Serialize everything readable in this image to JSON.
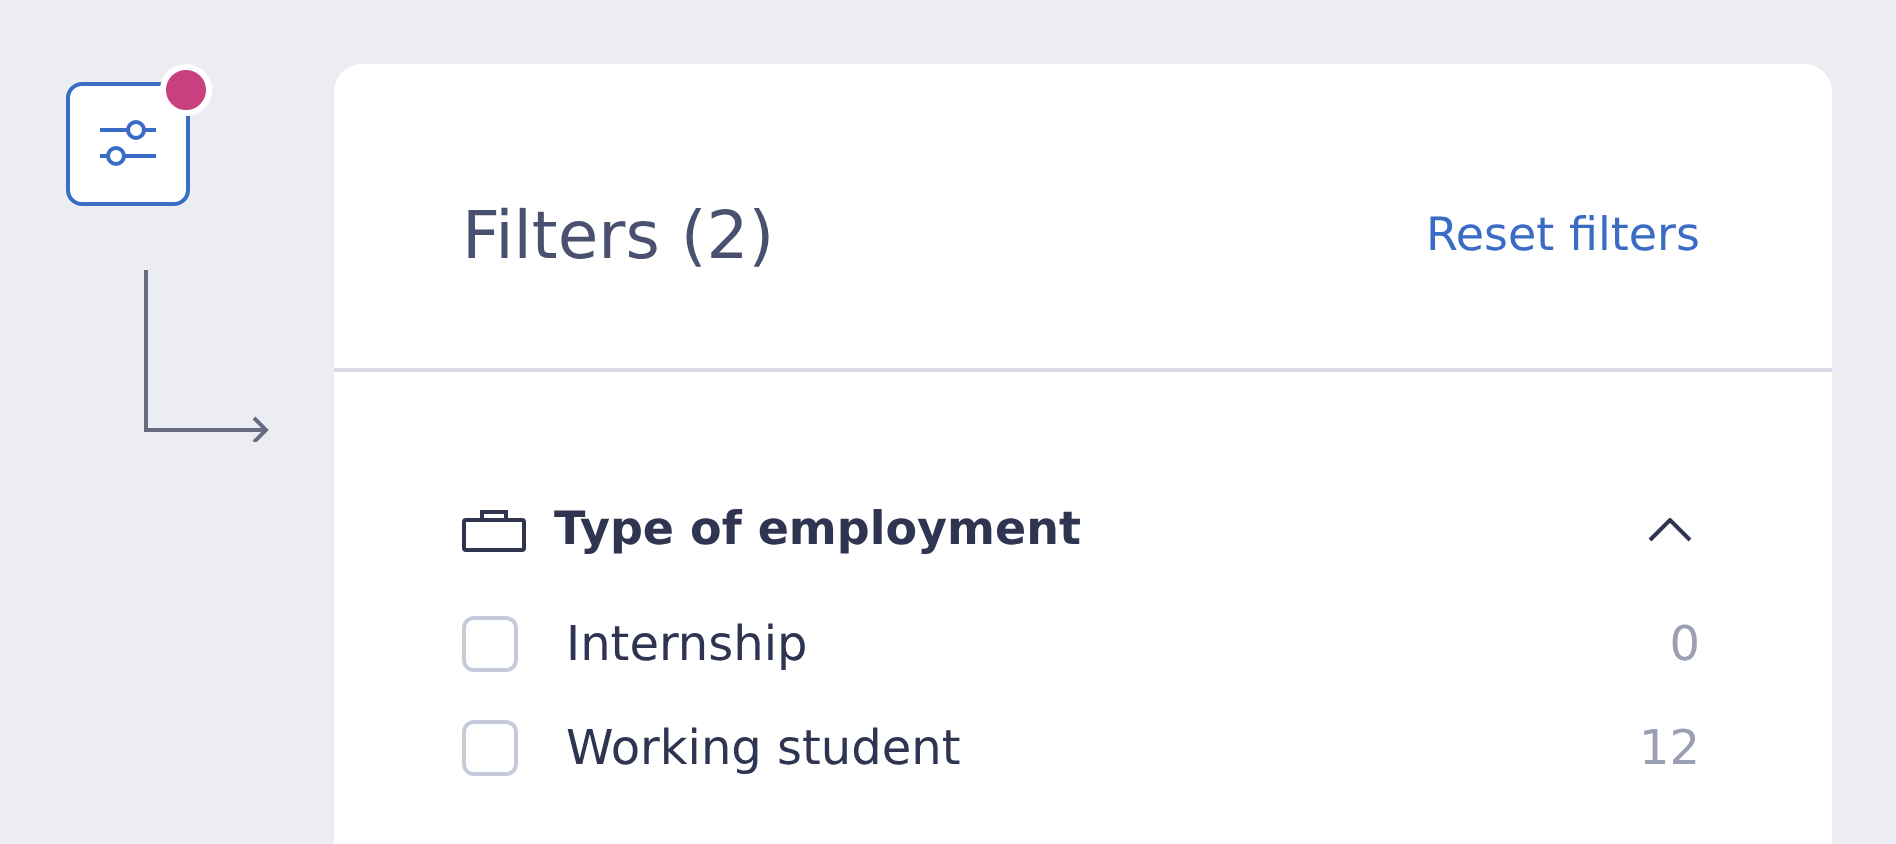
{
  "filter_button": {
    "has_active_filters": true
  },
  "panel": {
    "title": "Filters (2)",
    "reset_link": "Reset filters",
    "sections": [
      {
        "title": "Type of employment",
        "expanded": true,
        "options": [
          {
            "label": "Internship",
            "count": "0",
            "checked": false
          },
          {
            "label": "Working student",
            "count": "12",
            "checked": false
          }
        ]
      }
    ]
  }
}
